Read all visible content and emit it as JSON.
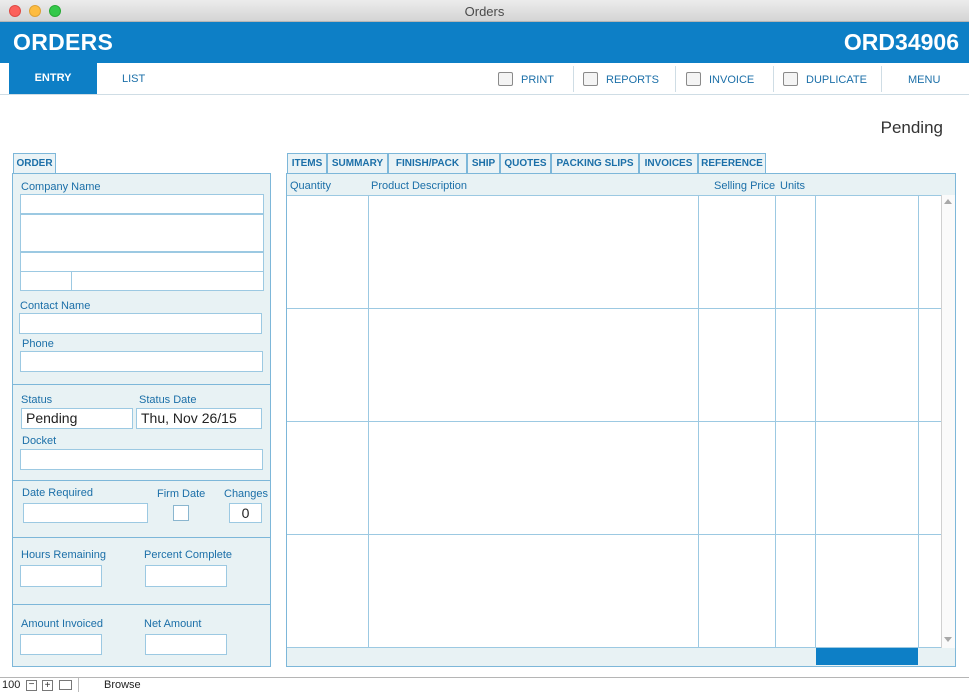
{
  "window": {
    "title": "Orders"
  },
  "header": {
    "title": "ORDERS",
    "order_id": "ORD34906"
  },
  "nav": {
    "entry": "ENTRY",
    "list": "LIST",
    "print": "PRINT",
    "reports": "REPORTS",
    "invoice": "INVOICE",
    "duplicate": "DUPLICATE",
    "menu": "MENU"
  },
  "status_display": "Pending",
  "order_panel": {
    "tab": "ORDER",
    "company_name_label": "Company Name",
    "contact_name_label": "Contact Name",
    "phone_label": "Phone",
    "status_label": "Status",
    "status_value": "Pending",
    "status_date_label": "Status Date",
    "status_date_value": "Thu, Nov 26/15",
    "docket_label": "Docket",
    "date_required_label": "Date Required",
    "firm_date_label": "Firm Date",
    "changes_label": "Changes",
    "changes_value": "0",
    "hours_remaining_label": "Hours Remaining",
    "percent_complete_label": "Percent Complete",
    "amount_invoiced_label": "Amount Invoiced",
    "net_amount_label": "Net Amount"
  },
  "tabs": [
    "ITEMS",
    "SUMMARY",
    "FINISH/PACK",
    "SHIP",
    "QUOTES",
    "PACKING SLIPS",
    "INVOICES",
    "REFERENCE"
  ],
  "items_columns": {
    "quantity": "Quantity",
    "product_description": "Product Description",
    "selling_price": "Selling Price",
    "units": "Units"
  },
  "statusbar": {
    "zoom": "100",
    "mode": "Browse"
  },
  "colors": {
    "accent": "#0d7fc6",
    "panel_bg": "#e8f2f4",
    "label": "#1b6fa8"
  }
}
